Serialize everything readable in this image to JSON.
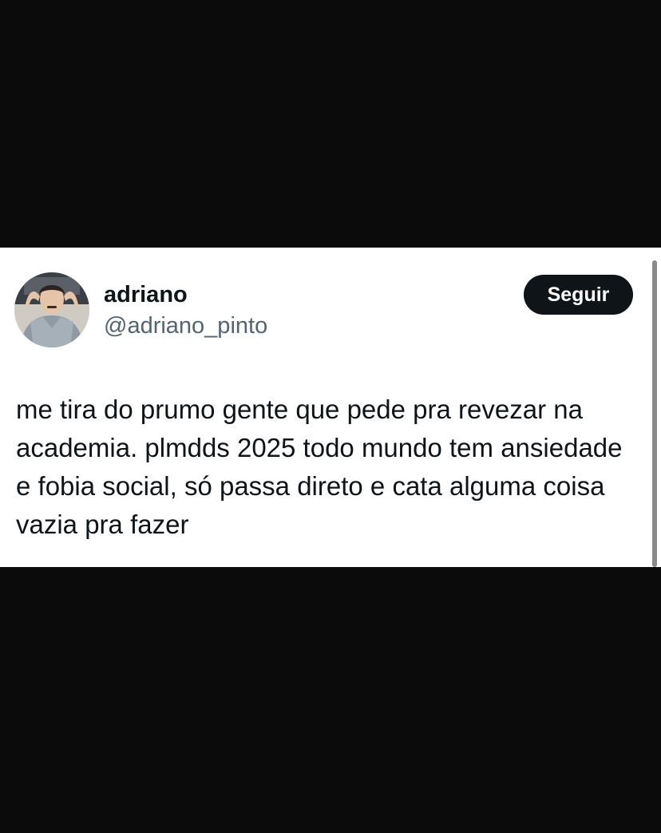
{
  "tweet": {
    "author": {
      "display_name": "adriano",
      "handle": "@adriano_pinto",
      "avatar_icon": "user-photo"
    },
    "follow_label": "Seguir",
    "text": "me tira do prumo gente que pede pra revezar na academia. plmdds 2025 todo mundo tem ansiedade e fobia social, só passa direto e cata alguma coisa vazia pra fazer"
  },
  "colors": {
    "background": "#0b0b0c",
    "card": "#ffffff",
    "name": "#0f1419",
    "handle": "#536471",
    "button_bg": "#0f1419",
    "button_text": "#ffffff"
  }
}
